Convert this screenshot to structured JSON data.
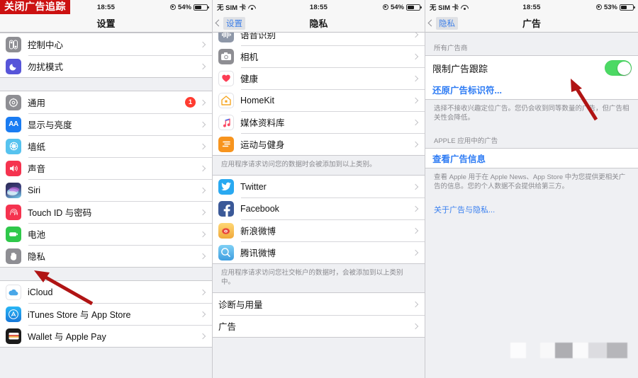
{
  "banner": {
    "text": "关闭广告追踪",
    "color": "#cc1111"
  },
  "panel1": {
    "status": {
      "time": "18:55",
      "battery": "54%",
      "carrier": ""
    },
    "nav": {
      "title": "设置",
      "back": ""
    },
    "groups": [
      {
        "rows": [
          {
            "label": "控制中心",
            "icon": "control-center-icon",
            "icon_color": "#8e8e93"
          },
          {
            "label": "勿扰模式",
            "icon": "do-not-disturb-icon",
            "icon_color": "#5755d9"
          }
        ]
      },
      {
        "rows": [
          {
            "label": "通用",
            "icon": "gear-icon",
            "icon_color": "#8e8e93",
            "badge": "1"
          },
          {
            "label": "显示与亮度",
            "icon": "display-brightness-icon",
            "icon_color": "#1a7cf2"
          },
          {
            "label": "墙纸",
            "icon": "wallpaper-icon",
            "icon_color": "#56c3ef"
          },
          {
            "label": "声音",
            "icon": "sound-icon",
            "icon_color": "#f5334f"
          },
          {
            "label": "Siri",
            "icon": "siri-icon",
            "icon_color": "#3a3a6e"
          },
          {
            "label": "Touch ID 与密码",
            "icon": "touch-id-icon",
            "icon_color": "#f5334f"
          },
          {
            "label": "电池",
            "icon": "battery-icon",
            "icon_color": "#2fc84a"
          },
          {
            "label": "隐私",
            "icon": "privacy-hand-icon",
            "icon_color": "#8e8e93"
          }
        ]
      },
      {
        "rows": [
          {
            "label": "iCloud",
            "icon": "icloud-icon",
            "icon_color": "#ffffff"
          },
          {
            "label": "iTunes Store 与 App Store",
            "icon": "app-store-icon",
            "icon_color": "#1a9ef2"
          },
          {
            "label": "Wallet 与 Apple Pay",
            "icon": "wallet-icon",
            "icon_color": "#1b1b1b"
          }
        ]
      }
    ]
  },
  "panel2": {
    "status": {
      "carrier": "无 SIM 卡",
      "time": "18:55",
      "battery": "54%"
    },
    "nav": {
      "back": "设置",
      "title": "隐私"
    },
    "group_a": {
      "rows": [
        {
          "label": "语音识别",
          "icon": "speech-recognition-icon",
          "icon_color": "#8e97a8"
        },
        {
          "label": "相机",
          "icon": "camera-icon",
          "icon_color": "#8e8e93"
        },
        {
          "label": "健康",
          "icon": "health-heart-icon",
          "icon_color": "#ffffff"
        },
        {
          "label": "HomeKit",
          "icon": "homekit-icon",
          "icon_color": "#f6a623"
        },
        {
          "label": "媒体资料库",
          "icon": "media-library-icon",
          "icon_color": "#ffffff"
        },
        {
          "label": "运动与健身",
          "icon": "fitness-icon",
          "icon_color": "#f7941e"
        }
      ],
      "footnote": "应用程序请求访问您的数据时会被添加到以上类别。"
    },
    "group_b": {
      "rows": [
        {
          "label": "Twitter",
          "icon": "twitter-icon",
          "icon_color": "#29a9f1"
        },
        {
          "label": "Facebook",
          "icon": "facebook-icon",
          "icon_color": "#3b5998"
        },
        {
          "label": "新浪微博",
          "icon": "sina-weibo-icon",
          "icon_color": "#f5c44c"
        },
        {
          "label": "腾讯微博",
          "icon": "tencent-weibo-icon",
          "icon_color": "#4fa8e8"
        }
      ],
      "footnote": "应用程序请求访问您社交帐户的数据时，会被添加到以上类别中。"
    },
    "group_c": {
      "rows": [
        {
          "label": "诊断与用量"
        },
        {
          "label": "广告"
        }
      ]
    }
  },
  "panel3": {
    "status": {
      "carrier": "无 SIM 卡",
      "time": "18:55",
      "battery": "53%"
    },
    "nav": {
      "back": "隐私",
      "title": "广告"
    },
    "section1_header": "所有广告商",
    "toggle_row": {
      "label": "限制广告跟踪",
      "state": "on",
      "on_color": "#4cd964"
    },
    "reset_link": "还原广告标识符...",
    "footnote1": "选择不接收兴趣定位广告。您仍会收到同等数量的广告，但广告相关性会降低。",
    "section2_header": "APPLE 应用中的广告",
    "view_ads_link": "查看广告信息",
    "footnote2": "查看 Apple 用于在 Apple News、App Store 中为您提供更相关广告的信息。您的个人数据不会提供给第三方。",
    "about_link": "关于广告与隐私..."
  }
}
